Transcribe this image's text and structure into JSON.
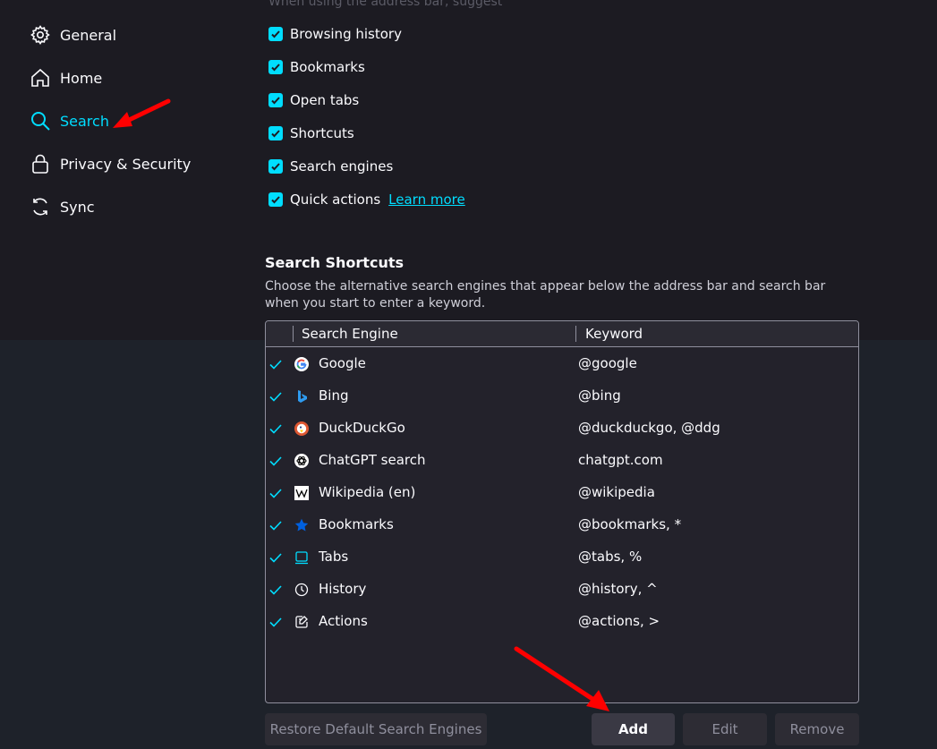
{
  "sidebar": {
    "items": [
      {
        "label": "General",
        "icon": "gear-icon"
      },
      {
        "label": "Home",
        "icon": "home-icon"
      },
      {
        "label": "Search",
        "icon": "search-icon",
        "active": true
      },
      {
        "label": "Privacy & Security",
        "icon": "lock-icon"
      },
      {
        "label": "Sync",
        "icon": "sync-icon"
      }
    ]
  },
  "suggest": {
    "heading": "When using the address bar, suggest",
    "options": [
      {
        "label": "Browsing history",
        "checked": true
      },
      {
        "label": "Bookmarks",
        "checked": true
      },
      {
        "label": "Open tabs",
        "checked": true
      },
      {
        "label": "Shortcuts",
        "checked": true
      },
      {
        "label": "Search engines",
        "checked": true
      },
      {
        "label": "Quick actions",
        "checked": true
      }
    ],
    "learn_more": "Learn more"
  },
  "shortcuts": {
    "title": "Search Shortcuts",
    "description": "Choose the alternative search engines that appear below the address bar and search bar when you start to enter a keyword.",
    "columns": {
      "engine": "Search Engine",
      "keyword": "Keyword"
    },
    "rows": [
      {
        "name": "Google",
        "keyword": "@google",
        "icon": "google-icon"
      },
      {
        "name": "Bing",
        "keyword": "@bing",
        "icon": "bing-icon"
      },
      {
        "name": "DuckDuckGo",
        "keyword": "@duckduckgo, @ddg",
        "icon": "duckduckgo-icon"
      },
      {
        "name": "ChatGPT search",
        "keyword": "chatgpt.com",
        "icon": "chatgpt-icon"
      },
      {
        "name": "Wikipedia (en)",
        "keyword": "@wikipedia",
        "icon": "wikipedia-icon"
      },
      {
        "name": "Bookmarks",
        "keyword": "@bookmarks, *",
        "icon": "star-icon"
      },
      {
        "name": "Tabs",
        "keyword": "@tabs, %",
        "icon": "tab-icon"
      },
      {
        "name": "History",
        "keyword": "@history, ^",
        "icon": "clock-icon"
      },
      {
        "name": "Actions",
        "keyword": "@actions, >",
        "icon": "actions-icon"
      }
    ]
  },
  "buttons": {
    "restore": "Restore Default Search Engines",
    "add": "Add",
    "edit": "Edit",
    "remove": "Remove"
  },
  "colors": {
    "accent": "#00ddff",
    "background": "#1c1b22",
    "annotation_arrow": "#ff0000"
  }
}
